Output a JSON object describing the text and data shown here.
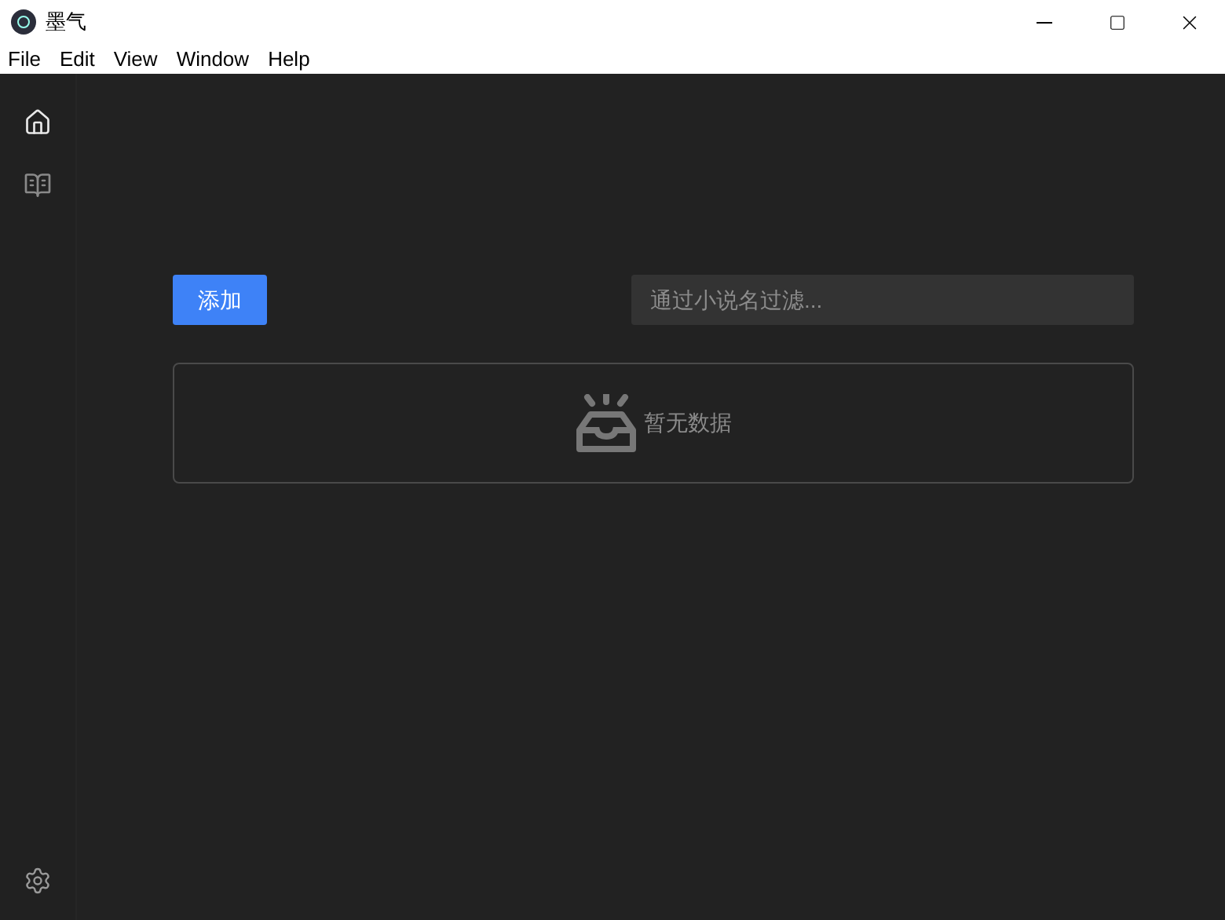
{
  "window": {
    "title": "墨气"
  },
  "menu": [
    "File",
    "Edit",
    "View",
    "Window",
    "Help"
  ],
  "sidebar": {
    "items": [
      {
        "kind": "home",
        "selected": true
      },
      {
        "kind": "book",
        "selected": false
      }
    ]
  },
  "toolbar": {
    "add_button": "添加",
    "filter": {
      "placeholder": "通过小说名过滤..."
    }
  },
  "empty_state": {
    "text": "暂无数据"
  }
}
